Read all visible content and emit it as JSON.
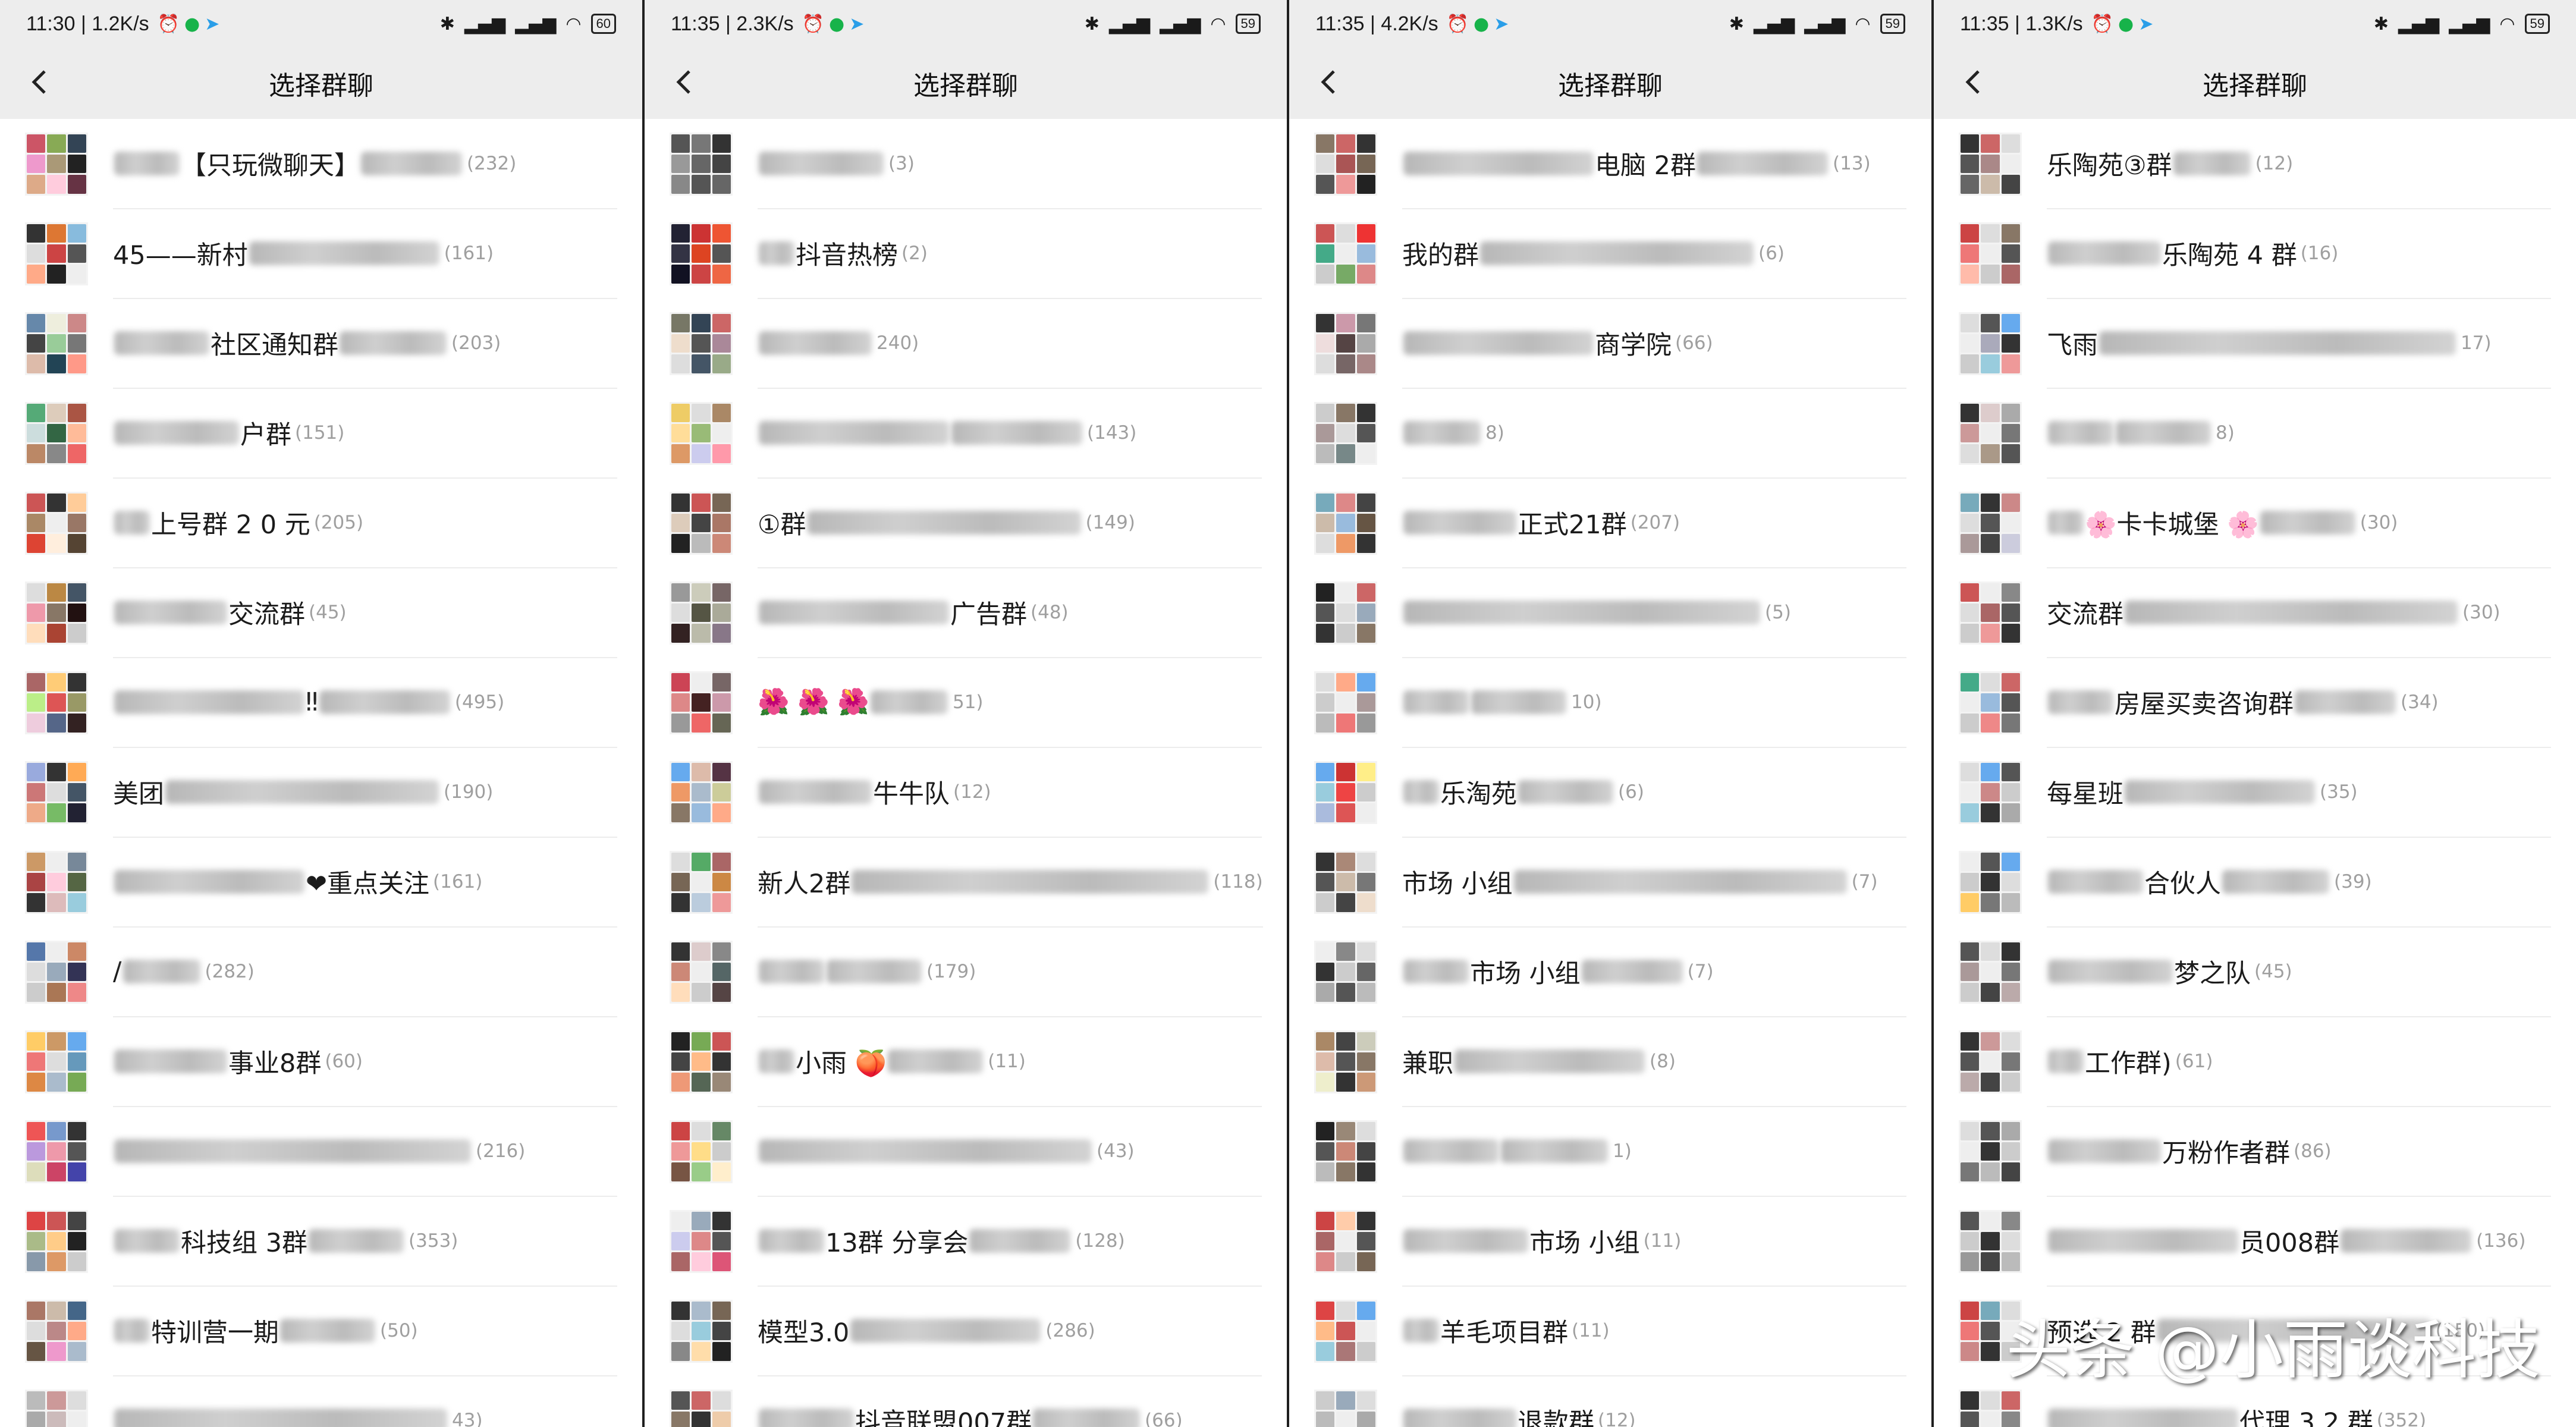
{
  "app": {
    "title": "选择群聊"
  },
  "panels": [
    {
      "status": {
        "time": "11:30 | 1.2K/s",
        "battery": "60"
      },
      "rows": [
        {
          "name": "【只玩微聊天】",
          "count": "(232)",
          "colors": [
            "#c56",
            "#8a5",
            "#345",
            "#e9c",
            "#a97",
            "#222",
            "#da8",
            "#fcd",
            "#634"
          ]
        },
        {
          "name": "45——新村",
          "count": "(161)",
          "colors": [
            "#333",
            "#d73",
            "#8bd",
            "#ddd",
            "#c44",
            "#555",
            "#fa8",
            "#222",
            "#eee"
          ]
        },
        {
          "name": "社区通知群",
          "count": "(203)",
          "colors": [
            "#68a",
            "#eed",
            "#c88",
            "#444",
            "#9c9",
            "#777",
            "#dba",
            "#245",
            "#f98"
          ]
        },
        {
          "name": "户群",
          "count": "(151)",
          "colors": [
            "#5a7",
            "#dcb",
            "#a54",
            "#cdd",
            "#364",
            "#fb9",
            "#b86",
            "#888",
            "#e66"
          ]
        },
        {
          "name": "上号群 2 0 元",
          "count": "(205)",
          "colors": [
            "#c55",
            "#333",
            "#fc9",
            "#a86",
            "#eee",
            "#976",
            "#d43",
            "#fed",
            "#543"
          ]
        },
        {
          "name": "交流群",
          "count": "(45)",
          "colors": [
            "#ddd",
            "#b84",
            "#456",
            "#e9a",
            "#876",
            "#211",
            "#fdb",
            "#a43",
            "#ccc"
          ]
        },
        {
          "name": "‼",
          "count": "(495)",
          "colors": [
            "#a66",
            "#fc7",
            "#333",
            "#be8",
            "#d55",
            "#996",
            "#ecd",
            "#568",
            "#322"
          ]
        },
        {
          "name": "美团",
          "count": "(190)",
          "colors": [
            "#9ad",
            "#333",
            "#fa5",
            "#c77",
            "#ddd",
            "#456",
            "#ea8",
            "#7b6",
            "#223"
          ]
        },
        {
          "name": "❤重点关注",
          "count": "(161)",
          "colors": [
            "#c96",
            "#eee",
            "#789",
            "#a44",
            "#fcd",
            "#564",
            "#333",
            "#dbb",
            "#9cd"
          ]
        },
        {
          "name": "/",
          "count": "(282)",
          "colors": [
            "#57a",
            "#eee",
            "#c86",
            "#ddd",
            "#9ab",
            "#335",
            "#ccc",
            "#a75",
            "#e88"
          ]
        },
        {
          "name": "事业8群",
          "count": "(60)",
          "colors": [
            "#fc6",
            "#c96",
            "#6ae",
            "#e77",
            "#ddd",
            "#69b",
            "#d84",
            "#abc",
            "#7a5"
          ]
        },
        {
          "name": "",
          "count": "(216)",
          "colors": [
            "#e55",
            "#79c",
            "#333",
            "#b9d",
            "#e9a",
            "#555",
            "#ddb",
            "#c46",
            "#44a"
          ]
        },
        {
          "name": "科技组 3群",
          "count": "(353)",
          "colors": [
            "#d44",
            "#c55",
            "#444",
            "#ab8",
            "#fc8",
            "#222",
            "#89a",
            "#d96",
            "#ccc"
          ]
        },
        {
          "name": "特训营一期",
          "count": "(50)",
          "colors": [
            "#a76",
            "#cba",
            "#468",
            "#ddd",
            "#b88",
            "#fa8",
            "#654",
            "#e9c",
            "#abc"
          ]
        },
        {
          "name": "",
          "count": "43)",
          "colors": [
            "#bbb",
            "#c99",
            "#ddd",
            "#aaa",
            "#cbb",
            "#eee",
            "#999",
            "#dcc",
            "#bbb"
          ]
        }
      ]
    },
    {
      "status": {
        "time": "11:35 | 2.3K/s",
        "battery": "59"
      },
      "rows": [
        {
          "name": "",
          "count": "(3)",
          "colors": [
            "#555",
            "#777",
            "#333",
            "#999",
            "#666",
            "#444",
            "#888",
            "#555",
            "#666"
          ]
        },
        {
          "name": "抖音热榜",
          "count": "(2)",
          "colors": [
            "#223",
            "#c33",
            "#e53",
            "#334",
            "#d42",
            "#555",
            "#112",
            "#c44",
            "#e64"
          ]
        },
        {
          "name": "",
          "count": "240)",
          "colors": [
            "#776",
            "#345",
            "#c66",
            "#edc",
            "#555",
            "#a89",
            "#ddd",
            "#456",
            "#9a8"
          ]
        },
        {
          "name": "",
          "count": "(143)",
          "colors": [
            "#ec6",
            "#ddd",
            "#a86",
            "#fd9",
            "#9b7",
            "#eee",
            "#d96",
            "#cce",
            "#f9a"
          ]
        },
        {
          "name": "①群",
          "count": "(149)",
          "colors": [
            "#333",
            "#c55",
            "#765",
            "#dcb",
            "#444",
            "#a76",
            "#222",
            "#bbb",
            "#c87"
          ]
        },
        {
          "name": "广告群",
          "count": "(48)",
          "colors": [
            "#999",
            "#ccb",
            "#766",
            "#ddd",
            "#554",
            "#aa9",
            "#322",
            "#bba",
            "#878"
          ]
        },
        {
          "name": "🌺 🌺 🌺",
          "count": "51)",
          "colors": [
            "#c45",
            "#eee",
            "#766",
            "#d88",
            "#422",
            "#c9a",
            "#999",
            "#e66",
            "#665"
          ]
        },
        {
          "name": "牛牛队",
          "count": "(12)",
          "colors": [
            "#6ae",
            "#dba",
            "#534",
            "#e96",
            "#abc",
            "#cc9",
            "#876",
            "#9bd",
            "#fa8"
          ]
        },
        {
          "name": "新人2群",
          "count": "(118)",
          "colors": [
            "#ddd",
            "#5a6",
            "#a66",
            "#765",
            "#eee",
            "#c84",
            "#333",
            "#bcd",
            "#e99"
          ]
        },
        {
          "name": "",
          "count": "(179)",
          "colors": [
            "#333",
            "#dcc",
            "#888",
            "#c87",
            "#eee",
            "#566",
            "#fdb",
            "#ccc",
            "#544"
          ]
        },
        {
          "name": "小雨 🍑",
          "count": "(11)",
          "colors": [
            "#222",
            "#7a5",
            "#c55",
            "#444",
            "#fb8",
            "#333",
            "#e97",
            "#565",
            "#987"
          ]
        },
        {
          "name": "",
          "count": "(43)",
          "colors": [
            "#c44",
            "#ddd",
            "#686",
            "#e99",
            "#fd8",
            "#ccc",
            "#754",
            "#9c8",
            "#fec"
          ]
        },
        {
          "name": "13群 分享会",
          "count": "(128)",
          "colors": [
            "#eee",
            "#9ab",
            "#333",
            "#cce",
            "#d88",
            "#555",
            "#a66",
            "#fcd",
            "#d57"
          ]
        },
        {
          "name": "模型3.0",
          "count": "(286)",
          "colors": [
            "#333",
            "#abc",
            "#765",
            "#ddd",
            "#9cd",
            "#444",
            "#888",
            "#fda",
            "#222"
          ]
        },
        {
          "name": "抖音联盟007群",
          "count": "(66)",
          "colors": [
            "#555",
            "#c66",
            "#ddd",
            "#876",
            "#333",
            "#eca",
            "#444",
            "#bbb",
            "#a77"
          ]
        }
      ]
    },
    {
      "status": {
        "time": "11:35 | 4.2K/s",
        "battery": "59"
      },
      "rows": [
        {
          "name": "电脑 2群",
          "count": "(13)",
          "colors": [
            "#876",
            "#c66",
            "#333",
            "#ddd",
            "#a55",
            "#765",
            "#555",
            "#e99",
            "#222"
          ]
        },
        {
          "name": "我的群",
          "count": "(6)",
          "colors": [
            "#c55",
            "#ddd",
            "#e33",
            "#4a8",
            "#eee",
            "#9bd",
            "#ccc",
            "#7a6",
            "#d88"
          ]
        },
        {
          "name": "商学院",
          "count": "(66)",
          "colors": [
            "#333",
            "#c9a",
            "#777",
            "#edd",
            "#544",
            "#aaa",
            "#ddd",
            "#766",
            "#a88"
          ]
        },
        {
          "name": "",
          "count": "8)",
          "colors": [
            "#ccc",
            "#876",
            "#333",
            "#a99",
            "#ddd",
            "#555",
            "#bbb",
            "#788",
            "#eee"
          ]
        },
        {
          "name": "正式21群",
          "count": "(207)",
          "colors": [
            "#7ab",
            "#d88",
            "#444",
            "#cba",
            "#9bd",
            "#654",
            "#ddd",
            "#e96",
            "#333"
          ]
        },
        {
          "name": "",
          "count": "(5)",
          "colors": [
            "#222",
            "#eee",
            "#c66",
            "#555",
            "#ddd",
            "#9ab",
            "#333",
            "#ccc",
            "#876"
          ]
        },
        {
          "name": "",
          "count": "10)",
          "colors": [
            "#ddd",
            "#fa8",
            "#6ae",
            "#ccc",
            "#eee",
            "#a99",
            "#bbb",
            "#e77",
            "#999"
          ]
        },
        {
          "name": "乐淘苑",
          "count": "(6)",
          "colors": [
            "#6ae",
            "#c33",
            "#fe8",
            "#9cd",
            "#e44",
            "#ccc",
            "#abd",
            "#d55",
            "#eee"
          ]
        },
        {
          "name": "市场 小组",
          "count": "(7)",
          "colors": [
            "#333",
            "#a87",
            "#ddd",
            "#555",
            "#cba",
            "#777",
            "#ccc",
            "#444",
            "#edc"
          ]
        },
        {
          "name": "市场 小组",
          "count": "(7)",
          "colors": [
            "#eee",
            "#888",
            "#ddd",
            "#333",
            "#ccc",
            "#666",
            "#aaa",
            "#555",
            "#bbb"
          ]
        },
        {
          "name": "兼职",
          "count": "(8)",
          "colors": [
            "#a86",
            "#444",
            "#ccb",
            "#dba",
            "#555",
            "#876",
            "#eec",
            "#333",
            "#c97"
          ]
        },
        {
          "name": "",
          "count": "1)",
          "colors": [
            "#222",
            "#987",
            "#ddd",
            "#555",
            "#c87",
            "#444",
            "#bbb",
            "#876",
            "#333"
          ]
        },
        {
          "name": "市场 小组",
          "count": "(11)",
          "colors": [
            "#c44",
            "#fca",
            "#333",
            "#a66",
            "#eee",
            "#555",
            "#d88",
            "#ccc",
            "#765"
          ]
        },
        {
          "name": "羊毛项目群",
          "count": "(11)",
          "colors": [
            "#d44",
            "#ddd",
            "#6ae",
            "#fb8",
            "#c55",
            "#eee",
            "#9cd",
            "#a77",
            "#ccc"
          ]
        },
        {
          "name": "退款群",
          "count": "(12)",
          "colors": [
            "#ccc",
            "#9ab",
            "#ddd",
            "#bbb",
            "#eee",
            "#aaa",
            "#cde",
            "#999",
            "#ddd"
          ]
        }
      ]
    },
    {
      "status": {
        "time": "11:35 | 1.3K/s",
        "battery": "59"
      },
      "rows": [
        {
          "name": "乐陶苑③群",
          "count": "(12)",
          "colors": [
            "#333",
            "#c66",
            "#ddd",
            "#555",
            "#a88",
            "#eee",
            "#666",
            "#cba",
            "#444"
          ]
        },
        {
          "name": "乐陶苑 4 群",
          "count": "(16)",
          "colors": [
            "#c44",
            "#ddd",
            "#876",
            "#e77",
            "#eee",
            "#555",
            "#fba",
            "#ccc",
            "#a66"
          ]
        },
        {
          "name": "飞雨",
          "count": "17)",
          "colors": [
            "#ddd",
            "#555",
            "#6ae",
            "#eee",
            "#aab",
            "#333",
            "#ccc",
            "#9cd",
            "#e99"
          ]
        },
        {
          "name": "",
          "count": "8)",
          "colors": [
            "#333",
            "#dcc",
            "#aaa",
            "#c99",
            "#eee",
            "#777",
            "#ddd",
            "#a98",
            "#555"
          ]
        },
        {
          "name": "🌸卡卡城堡 🌸",
          "count": "(30)",
          "colors": [
            "#7ab",
            "#333",
            "#c88",
            "#ddd",
            "#555",
            "#eee",
            "#a99",
            "#444",
            "#ccd"
          ]
        },
        {
          "name": "交流群",
          "count": "(30)",
          "colors": [
            "#c55",
            "#eee",
            "#888",
            "#ddd",
            "#a66",
            "#555",
            "#ccc",
            "#e99",
            "#333"
          ]
        },
        {
          "name": "房屋买卖咨询群",
          "count": "(34)",
          "colors": [
            "#4a8",
            "#ddd",
            "#c66",
            "#eee",
            "#9bd",
            "#555",
            "#ccc",
            "#e88",
            "#777"
          ]
        },
        {
          "name": "每星班",
          "count": "(35)",
          "colors": [
            "#ddd",
            "#6ae",
            "#555",
            "#eee",
            "#c88",
            "#ccc",
            "#9cd",
            "#333",
            "#aaa"
          ]
        },
        {
          "name": "合伙人",
          "count": "(39)",
          "colors": [
            "#eee",
            "#555",
            "#6ae",
            "#ccc",
            "#333",
            "#ddd",
            "#fc6",
            "#777",
            "#bbb"
          ]
        },
        {
          "name": "梦之队",
          "count": "(45)",
          "colors": [
            "#555",
            "#ddd",
            "#333",
            "#a99",
            "#eee",
            "#777",
            "#ccc",
            "#444",
            "#baa"
          ]
        },
        {
          "name": "工作群)",
          "count": "(61)",
          "colors": [
            "#333",
            "#c99",
            "#ddd",
            "#555",
            "#eee",
            "#777",
            "#baa",
            "#444",
            "#ccc"
          ]
        },
        {
          "name": "万粉作者群",
          "count": "(86)",
          "colors": [
            "#ddd",
            "#555",
            "#aaa",
            "#eee",
            "#333",
            "#ccc",
            "#777",
            "#bbb",
            "#444"
          ]
        },
        {
          "name": "员008群",
          "count": "(136)",
          "colors": [
            "#555",
            "#eee",
            "#888",
            "#ccc",
            "#333",
            "#ddd",
            "#999",
            "#444",
            "#bbb"
          ]
        },
        {
          "name": "预选 2 群",
          "count": "(150)",
          "colors": [
            "#c44",
            "#7ab",
            "#ddd",
            "#e77",
            "#555",
            "#eee",
            "#c88",
            "#333",
            "#ccc"
          ]
        },
        {
          "name": "代理 3 2 群",
          "count": "(352)",
          "colors": [
            "#333",
            "#ddd",
            "#c66",
            "#555",
            "#eee",
            "#888",
            "#aaa",
            "#444",
            "#ccc"
          ]
        }
      ]
    }
  ],
  "watermark": "头条 @小雨谈科技"
}
